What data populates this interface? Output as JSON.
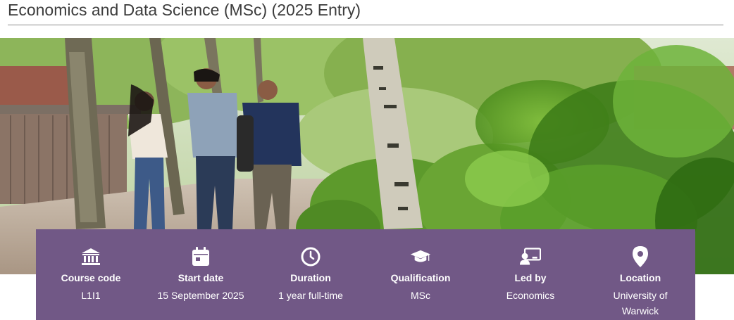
{
  "page": {
    "title": "Economics and Data Science (MSc) (2025 Entry)"
  },
  "hero": {
    "image": "hero-photo"
  },
  "info_bar": {
    "background": "#715886",
    "items": [
      {
        "icon": "institution-icon",
        "label": "Course code",
        "value": "L1I1"
      },
      {
        "icon": "calendar-icon",
        "label": "Start date",
        "value": "15 September 2025"
      },
      {
        "icon": "clock-icon",
        "label": "Duration",
        "value": "1 year full-time"
      },
      {
        "icon": "graduation-cap-icon",
        "label": "Qualification",
        "value": "MSc"
      },
      {
        "icon": "presenter-icon",
        "label": "Led by",
        "value": "Economics"
      },
      {
        "icon": "map-pin-icon",
        "label": "Location",
        "value": "University of Warwick"
      }
    ]
  }
}
